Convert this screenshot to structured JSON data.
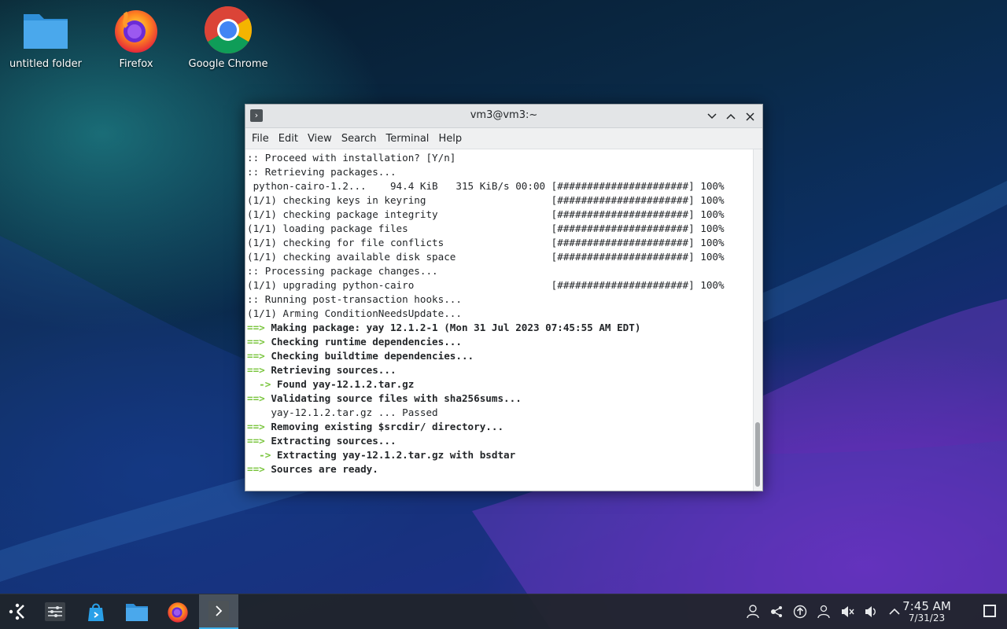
{
  "desktop": {
    "icons": [
      {
        "label": "untitled folder",
        "icon": "folder-icon"
      },
      {
        "label": "Firefox",
        "icon": "firefox-icon"
      },
      {
        "label": "Google Chrome",
        "icon": "chrome-icon"
      }
    ]
  },
  "window": {
    "title": "vm3@vm3:~",
    "menu": [
      "File",
      "Edit",
      "View",
      "Search",
      "Terminal",
      "Help"
    ],
    "lines": [
      {
        "prefix": "",
        "text": ":: Proceed with installation? [Y/n]",
        "bold": false
      },
      {
        "prefix": "",
        "text": ":: Retrieving packages...",
        "bold": false
      },
      {
        "prefix": "",
        "text": " python-cairo-1.2...    94.4 KiB   315 KiB/s 00:00 [######################] 100%",
        "bold": false
      },
      {
        "prefix": "",
        "text": "(1/1) checking keys in keyring                     [######################] 100%",
        "bold": false
      },
      {
        "prefix": "",
        "text": "(1/1) checking package integrity                   [######################] 100%",
        "bold": false
      },
      {
        "prefix": "",
        "text": "(1/1) loading package files                        [######################] 100%",
        "bold": false
      },
      {
        "prefix": "",
        "text": "(1/1) checking for file conflicts                  [######################] 100%",
        "bold": false
      },
      {
        "prefix": "",
        "text": "(1/1) checking available disk space                [######################] 100%",
        "bold": false
      },
      {
        "prefix": "",
        "text": ":: Processing package changes...",
        "bold": false
      },
      {
        "prefix": "",
        "text": "(1/1) upgrading python-cairo                       [######################] 100%",
        "bold": false
      },
      {
        "prefix": "",
        "text": ":: Running post-transaction hooks...",
        "bold": false
      },
      {
        "prefix": "",
        "text": "(1/1) Arming ConditionNeedsUpdate...",
        "bold": false
      },
      {
        "prefix": "==>",
        "text": " Making package: yay 12.1.2-1 (Mon 31 Jul 2023 07:45:55 AM EDT)",
        "bold": true
      },
      {
        "prefix": "==>",
        "text": " Checking runtime dependencies...",
        "bold": true
      },
      {
        "prefix": "==>",
        "text": " Checking buildtime dependencies...",
        "bold": true
      },
      {
        "prefix": "==>",
        "text": " Retrieving sources...",
        "bold": true
      },
      {
        "prefix": "  ->",
        "text": " Found yay-12.1.2.tar.gz",
        "bold": true
      },
      {
        "prefix": "==>",
        "text": " Validating source files with sha256sums...",
        "bold": true
      },
      {
        "prefix": "",
        "text": "    yay-12.1.2.tar.gz ... Passed",
        "bold": false
      },
      {
        "prefix": "==>",
        "text": " Removing existing $srcdir/ directory...",
        "bold": true
      },
      {
        "prefix": "==>",
        "text": " Extracting sources...",
        "bold": true
      },
      {
        "prefix": "  ->",
        "text": " Extracting yay-12.1.2.tar.gz with bsdtar",
        "bold": true
      },
      {
        "prefix": "==>",
        "text": " Sources are ready.",
        "bold": true
      }
    ]
  },
  "taskbar": {
    "items": [
      {
        "icon": "application-launcher-icon"
      },
      {
        "icon": "system-settings-icon"
      },
      {
        "icon": "discover-store-icon"
      },
      {
        "icon": "dolphin-folder-icon"
      },
      {
        "icon": "firefox-icon"
      },
      {
        "icon": "konsole-terminal-icon",
        "active": true
      }
    ],
    "tray": [
      "user-icon",
      "kde-connect-icon",
      "updates-icon",
      "users-icon",
      "speaker-muted-icon",
      "volume-icon",
      "chevron-up-icon"
    ],
    "clock": {
      "time": "7:45 AM",
      "date": "7/31/23"
    }
  }
}
